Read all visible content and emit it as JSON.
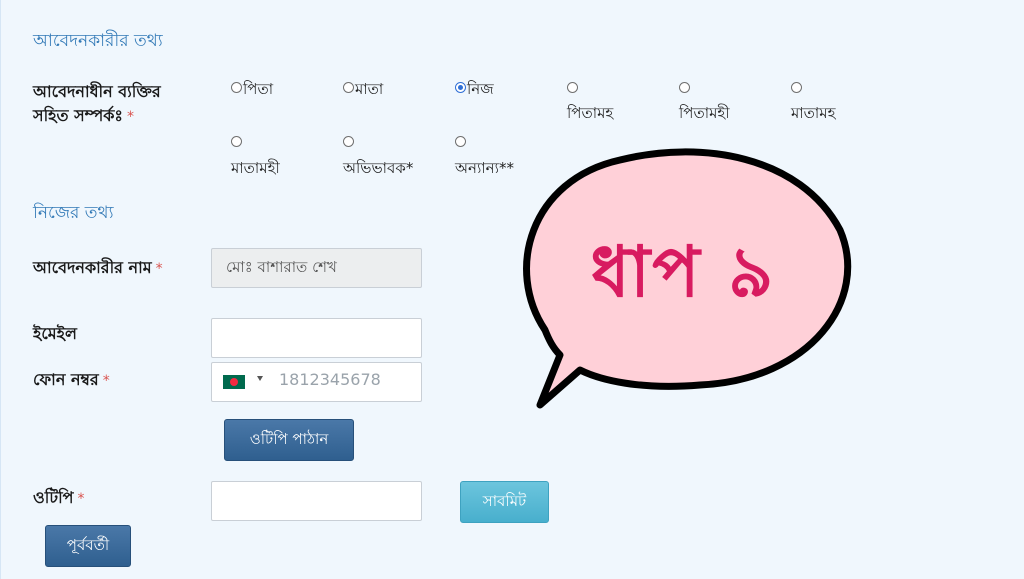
{
  "section_applicant": "আবেদনকারীর তথ্য",
  "relation": {
    "label": "আবেদনাধীন ব্যক্তির সহিত সম্পর্কঃ",
    "required": "*",
    "options": [
      "পিতা",
      "মাতা",
      "নিজ",
      "পিতামহ",
      "পিতামহী",
      "মাতামহ",
      "মাতামহী",
      "অভিভাবক*",
      "অন্যান্য**"
    ],
    "selected": "নিজ"
  },
  "section_self": "নিজের তথ্য",
  "name": {
    "label": "আবেদনকারীর নাম",
    "required": "*",
    "value": "মোঃ বাশারাত শেখ"
  },
  "email": {
    "label": "ইমেইল",
    "value": ""
  },
  "phone": {
    "label": "ফোন নম্বর",
    "required": "*",
    "placeholder": "1812345678",
    "country_flag": "bangladesh-flag-icon"
  },
  "send_otp_button": "ওটিপি পাঠান",
  "otp": {
    "label": "ওটিপি",
    "required": "*",
    "value": ""
  },
  "submit_button": "সাবমিট",
  "prev_button": "পূর্ববর্তী",
  "bubble": {
    "text": "ধাপ ৯",
    "fill": "#ffd0d8",
    "text_color": "#d81b60"
  }
}
